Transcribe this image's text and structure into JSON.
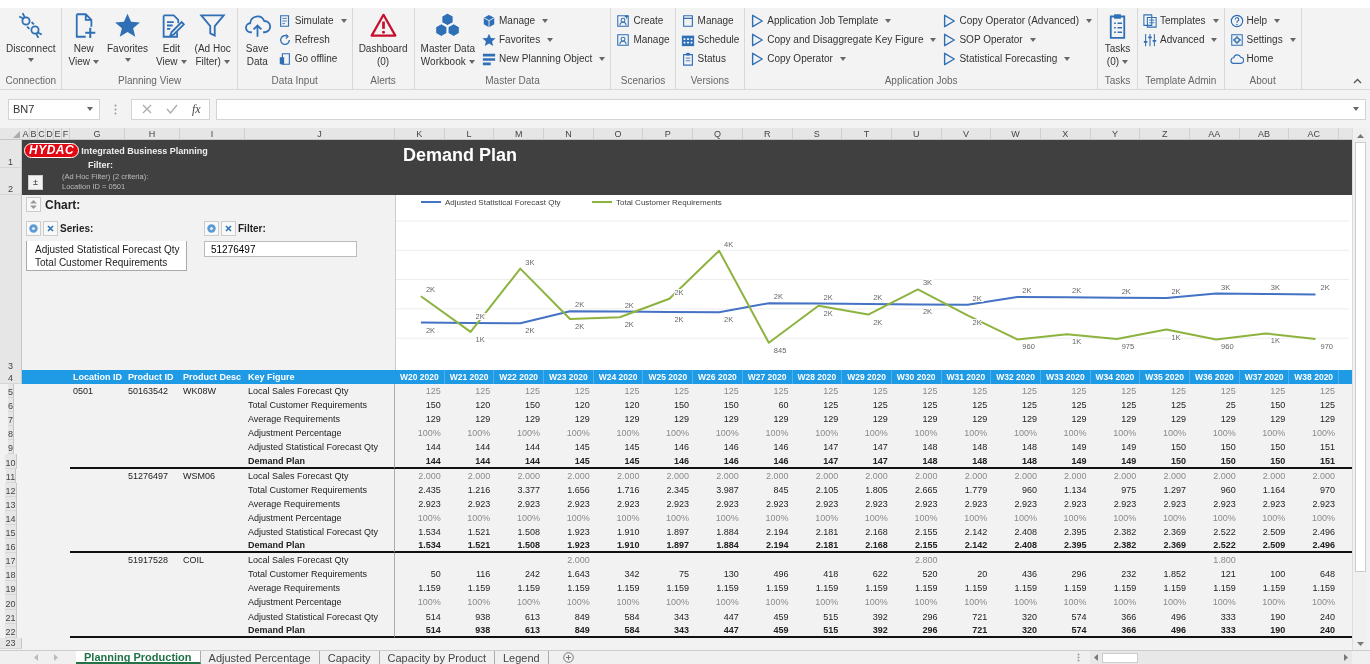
{
  "ribbon": {
    "groups": [
      {
        "label": "Connection",
        "items": [
          {
            "kind": "large",
            "lines": [
              "Disconnect"
            ],
            "dropdown": true
          }
        ]
      },
      {
        "label": "Planning View",
        "items": [
          {
            "kind": "large",
            "lines": [
              "New",
              "View"
            ],
            "dropdown": true
          },
          {
            "kind": "large",
            "lines": [
              "Favorites"
            ],
            "dropdown": true
          },
          {
            "kind": "large",
            "lines": [
              "Edit",
              "View"
            ],
            "dropdown": true
          },
          {
            "kind": "large",
            "lines": [
              "(Ad Hoc",
              "Filter)"
            ],
            "dropdown": true
          }
        ]
      },
      {
        "label": "Data Input",
        "items": [
          {
            "kind": "large",
            "lines": [
              "Save",
              "Data"
            ],
            "dropdown": false
          },
          {
            "kind": "small",
            "lines": [
              "Simulate"
            ],
            "dropdown": true
          },
          {
            "kind": "small",
            "lines": [
              "Refresh"
            ],
            "dropdown": false
          },
          {
            "kind": "small",
            "lines": [
              "Go offline"
            ],
            "dropdown": false
          }
        ]
      },
      {
        "label": "Alerts",
        "items": [
          {
            "kind": "large",
            "lines": [
              "Dashboard",
              "(0)"
            ],
            "dropdown": false
          }
        ]
      },
      {
        "label": "Master Data",
        "items": [
          {
            "kind": "large",
            "lines": [
              "Master Data",
              "Workbook"
            ],
            "dropdown": true
          },
          {
            "kind": "small",
            "lines": [
              "Manage"
            ],
            "dropdown": true
          },
          {
            "kind": "small",
            "lines": [
              "Favorites"
            ],
            "dropdown": true
          },
          {
            "kind": "small",
            "lines": [
              "New Planning Object"
            ],
            "dropdown": true
          }
        ]
      },
      {
        "label": "Scenarios",
        "items": [
          {
            "kind": "small",
            "lines": [
              "Create"
            ],
            "dropdown": false
          },
          {
            "kind": "small",
            "lines": [
              "Manage"
            ],
            "dropdown": false
          }
        ]
      },
      {
        "label": "Versions",
        "items": [
          {
            "kind": "small",
            "lines": [
              "Manage"
            ],
            "dropdown": false
          },
          {
            "kind": "small",
            "lines": [
              "Schedule"
            ],
            "dropdown": false
          },
          {
            "kind": "small",
            "lines": [
              "Status"
            ],
            "dropdown": false
          }
        ]
      },
      {
        "label": "Application Jobs",
        "items": [
          {
            "kind": "small",
            "lines": [
              "Application Job Template"
            ],
            "dropdown": true
          },
          {
            "kind": "small",
            "lines": [
              "Copy and Disaggregate Key Figure"
            ],
            "dropdown": true
          },
          {
            "kind": "small",
            "lines": [
              "Copy Operator"
            ],
            "dropdown": true
          },
          {
            "kind": "small",
            "lines": [
              "Copy Operator (Advanced)"
            ],
            "dropdown": true
          },
          {
            "kind": "small",
            "lines": [
              "SOP Operator"
            ],
            "dropdown": true
          },
          {
            "kind": "small",
            "lines": [
              "Statistical Forecasting"
            ],
            "dropdown": true
          }
        ]
      },
      {
        "label": "Tasks",
        "items": [
          {
            "kind": "large",
            "lines": [
              "Tasks",
              "(0)"
            ],
            "dropdown": true
          }
        ]
      },
      {
        "label": "Template Admin",
        "items": [
          {
            "kind": "small",
            "lines": [
              "Templates"
            ],
            "dropdown": true
          },
          {
            "kind": "small",
            "lines": [
              "Advanced"
            ],
            "dropdown": true
          }
        ]
      },
      {
        "label": "About",
        "items": [
          {
            "kind": "small",
            "lines": [
              "Help"
            ],
            "dropdown": true
          },
          {
            "kind": "small",
            "lines": [
              "Settings"
            ],
            "dropdown": true
          },
          {
            "kind": "small",
            "lines": [
              "Home"
            ],
            "dropdown": false
          }
        ]
      }
    ]
  },
  "formula_bar": {
    "name_box": "BN7",
    "function_label": "fx"
  },
  "column_headers": [
    "A",
    "B",
    "C",
    "D",
    "E",
    "F",
    "G",
    "H",
    "I",
    "J",
    "K",
    "L",
    "M",
    "N",
    "O",
    "P",
    "Q",
    "R",
    "S",
    "T",
    "U",
    "V",
    "W",
    "X",
    "Y",
    "Z",
    "AA",
    "AB",
    "AC"
  ],
  "row_numbers": [
    "1",
    "2",
    "3",
    "4",
    "5",
    "6",
    "7",
    "8",
    "9",
    "10",
    "11",
    "12",
    "13",
    "14",
    "15",
    "16",
    "17",
    "18",
    "19",
    "20",
    "21",
    "22",
    "23"
  ],
  "report_header": {
    "logo": "HYDAC",
    "app_title": "Integrated Business Planning",
    "filter_label": "Filter:",
    "toggle": "±",
    "filter_lines": [
      "(Ad Hoc Filter) (2 criteria):",
      "Location ID = 0501"
    ],
    "title": "Demand Plan"
  },
  "chart_panel": {
    "title": "Chart:",
    "series_label": "Series:",
    "series_items": [
      "Adjusted Statistical Forecast Qty",
      "Total Customer Requirements"
    ],
    "filter_label": "Filter:",
    "filter_value": "51276497"
  },
  "chart": {
    "chart_data": {
      "type": "line",
      "legend": true,
      "data_labels": true,
      "series": [
        {
          "name": "Adjusted Statistical Forecast Qty",
          "color": "#4472c4",
          "values": [
            1534,
            1521,
            1508,
            1923,
            1910,
            1897,
            1884,
            2194,
            2181,
            2168,
            2155,
            2142,
            2408,
            2395,
            2382,
            2369,
            2522,
            2509,
            2496
          ],
          "value_labels": [
            "2K",
            "2K",
            "2K",
            "2K",
            "2K",
            "2K",
            "2K",
            "2K",
            "2K",
            "2K",
            "2K",
            "2K",
            "2K",
            "2K",
            "2K",
            "2K",
            "3K",
            "3K",
            "2K"
          ]
        },
        {
          "name": "Total Customer Requirements",
          "color": "#8db33f",
          "values": [
            2435,
            1216,
            3377,
            1656,
            1716,
            2345,
            3987,
            845,
            2105,
            1805,
            2665,
            1779,
            960,
            1134,
            975,
            1297,
            960,
            1164,
            970
          ],
          "value_labels": [
            "2K",
            "1K",
            "3K",
            "2K",
            "2K",
            "2K",
            "4K",
            "845",
            "2K",
            "2K",
            "3K",
            "2K",
            "960",
            "1K",
            "975",
            "1K",
            "960",
            "1K",
            "970"
          ]
        }
      ]
    }
  },
  "table": {
    "columns": [
      "Location ID",
      "Product ID",
      "Product Desc",
      "Key Figure",
      "W20 2020",
      "W21 2020",
      "W22 2020",
      "W23 2020",
      "W24 2020",
      "W25 2020",
      "W26 2020",
      "W27 2020",
      "W28 2020",
      "W29 2020",
      "W30 2020",
      "W31 2020",
      "W32 2020",
      "W33 2020",
      "W34 2020",
      "W35 2020",
      "W36 2020",
      "W37 2020",
      "W38 2020"
    ],
    "products": [
      {
        "location_id": "0501",
        "product_id": "50163542",
        "product_desc": "WK08W",
        "key_figures": [
          {
            "name": "Local Sales Forecast Qty",
            "kind": "input",
            "values": [
              "125",
              "125",
              "125",
              "125",
              "125",
              "125",
              "125",
              "125",
              "125",
              "125",
              "125",
              "125",
              "125",
              "125",
              "125",
              "125",
              "125",
              "125",
              "125"
            ]
          },
          {
            "name": "Total Customer Requirements",
            "kind": "calc",
            "values": [
              "150",
              "120",
              "150",
              "120",
              "120",
              "150",
              "150",
              "60",
              "125",
              "125",
              "125",
              "125",
              "125",
              "125",
              "125",
              "125",
              "25",
              "150",
              "125"
            ]
          },
          {
            "name": "Average Requirements",
            "kind": "calc",
            "values": [
              "129",
              "129",
              "129",
              "129",
              "129",
              "129",
              "129",
              "129",
              "129",
              "129",
              "129",
              "129",
              "129",
              "129",
              "129",
              "129",
              "129",
              "129",
              "129"
            ]
          },
          {
            "name": "Adjustment Percentage",
            "kind": "input",
            "values": [
              "100%",
              "100%",
              "100%",
              "100%",
              "100%",
              "100%",
              "100%",
              "100%",
              "100%",
              "100%",
              "100%",
              "100%",
              "100%",
              "100%",
              "100%",
              "100%",
              "100%",
              "100%",
              "100%"
            ]
          },
          {
            "name": "Adjusted Statistical Forecast Qty",
            "kind": "calc",
            "values": [
              "144",
              "144",
              "144",
              "145",
              "145",
              "146",
              "146",
              "146",
              "147",
              "147",
              "148",
              "148",
              "148",
              "149",
              "149",
              "150",
              "150",
              "150",
              "151"
            ]
          },
          {
            "name": "Demand Plan",
            "kind": "total",
            "values": [
              "144",
              "144",
              "144",
              "145",
              "145",
              "146",
              "146",
              "146",
              "147",
              "147",
              "148",
              "148",
              "148",
              "149",
              "149",
              "150",
              "150",
              "150",
              "151"
            ]
          }
        ]
      },
      {
        "product_id": "51276497",
        "product_desc": "WSM06",
        "key_figures": [
          {
            "name": "Local Sales Forecast Qty",
            "kind": "input",
            "values": [
              "2.000",
              "2.000",
              "2.000",
              "2.000",
              "2.000",
              "2.000",
              "2.000",
              "2.000",
              "2.000",
              "2.000",
              "2.000",
              "2.000",
              "2.000",
              "2.000",
              "2.000",
              "2.000",
              "2.000",
              "2.000",
              "2.000"
            ]
          },
          {
            "name": "Total Customer Requirements",
            "kind": "calc",
            "values": [
              "2.435",
              "1.216",
              "3.377",
              "1.656",
              "1.716",
              "2.345",
              "3.987",
              "845",
              "2.105",
              "1.805",
              "2.665",
              "1.779",
              "960",
              "1.134",
              "975",
              "1.297",
              "960",
              "1.164",
              "970"
            ]
          },
          {
            "name": "Average Requirements",
            "kind": "calc",
            "values": [
              "2.923",
              "2.923",
              "2.923",
              "2.923",
              "2.923",
              "2.923",
              "2.923",
              "2.923",
              "2.923",
              "2.923",
              "2.923",
              "2.923",
              "2.923",
              "2.923",
              "2.923",
              "2.923",
              "2.923",
              "2.923",
              "2.923"
            ]
          },
          {
            "name": "Adjustment Percentage",
            "kind": "input",
            "values": [
              "100%",
              "100%",
              "100%",
              "100%",
              "100%",
              "100%",
              "100%",
              "100%",
              "100%",
              "100%",
              "100%",
              "100%",
              "100%",
              "100%",
              "100%",
              "100%",
              "100%",
              "100%",
              "100%"
            ]
          },
          {
            "name": "Adjusted Statistical Forecast Qty",
            "kind": "calc",
            "values": [
              "1.534",
              "1.521",
              "1.508",
              "1.923",
              "1.910",
              "1.897",
              "1.884",
              "2.194",
              "2.181",
              "2.168",
              "2.155",
              "2.142",
              "2.408",
              "2.395",
              "2.382",
              "2.369",
              "2.522",
              "2.509",
              "2.496"
            ]
          },
          {
            "name": "Demand Plan",
            "kind": "total",
            "values": [
              "1.534",
              "1.521",
              "1.508",
              "1.923",
              "1.910",
              "1.897",
              "1.884",
              "2.194",
              "2.181",
              "2.168",
              "2.155",
              "2.142",
              "2.408",
              "2.395",
              "2.382",
              "2.369",
              "2.522",
              "2.509",
              "2.496"
            ]
          }
        ]
      },
      {
        "product_id": "51917528",
        "product_desc": "COIL",
        "key_figures": [
          {
            "name": "Local Sales Forecast Qty",
            "kind": "input",
            "cells": [
              {
                "blank": true
              },
              {
                "blank": true
              },
              {
                "blank": true
              },
              {
                "value": "2.000"
              },
              {
                "blank": true
              },
              {
                "blank": true
              },
              {
                "blank": true
              },
              {
                "blank": true
              },
              {
                "blank": true
              },
              {
                "blank": true
              },
              {
                "value": "2.800"
              },
              {
                "blank": true
              },
              {
                "blank": true
              },
              {
                "blank": true
              },
              {
                "blank": true
              },
              {
                "blank": true
              },
              {
                "value": "1.800"
              },
              {
                "blank": true
              },
              {
                "blank": true
              }
            ]
          },
          {
            "name": "Total Customer Requirements",
            "kind": "calc",
            "values": [
              "50",
              "116",
              "242",
              "1.643",
              "342",
              "75",
              "130",
              "496",
              "418",
              "622",
              "520",
              "20",
              "436",
              "296",
              "232",
              "1.852",
              "121",
              "100",
              "648"
            ]
          },
          {
            "name": "Average Requirements",
            "kind": "calc",
            "values": [
              "1.159",
              "1.159",
              "1.159",
              "1.159",
              "1.159",
              "1.159",
              "1.159",
              "1.159",
              "1.159",
              "1.159",
              "1.159",
              "1.159",
              "1.159",
              "1.159",
              "1.159",
              "1.159",
              "1.159",
              "1.159",
              "1.159"
            ]
          },
          {
            "name": "Adjustment Percentage",
            "kind": "input",
            "values": [
              "100%",
              "100%",
              "100%",
              "100%",
              "100%",
              "100%",
              "100%",
              "100%",
              "100%",
              "100%",
              "100%",
              "100%",
              "100%",
              "100%",
              "100%",
              "100%",
              "100%",
              "100%",
              "100%"
            ]
          },
          {
            "name": "Adjusted Statistical Forecast Qty",
            "kind": "calc",
            "values": [
              "514",
              "938",
              "613",
              "849",
              "584",
              "343",
              "447",
              "459",
              "515",
              "392",
              "296",
              "721",
              "320",
              "574",
              "366",
              "496",
              "333",
              "190",
              "240"
            ]
          },
          {
            "name": "Demand Plan",
            "kind": "total",
            "values": [
              "514",
              "938",
              "613",
              "849",
              "584",
              "343",
              "447",
              "459",
              "515",
              "392",
              "296",
              "721",
              "320",
              "574",
              "366",
              "496",
              "333",
              "190",
              "240"
            ]
          }
        ]
      }
    ]
  },
  "sheet_tabs": [
    {
      "label": "Planning Production",
      "selected": true
    },
    {
      "label": "Adjusted Percentage",
      "selected": false
    },
    {
      "label": "Capacity",
      "selected": false
    },
    {
      "label": "Capacity by Product",
      "selected": false
    },
    {
      "label": "Legend",
      "selected": false
    }
  ]
}
